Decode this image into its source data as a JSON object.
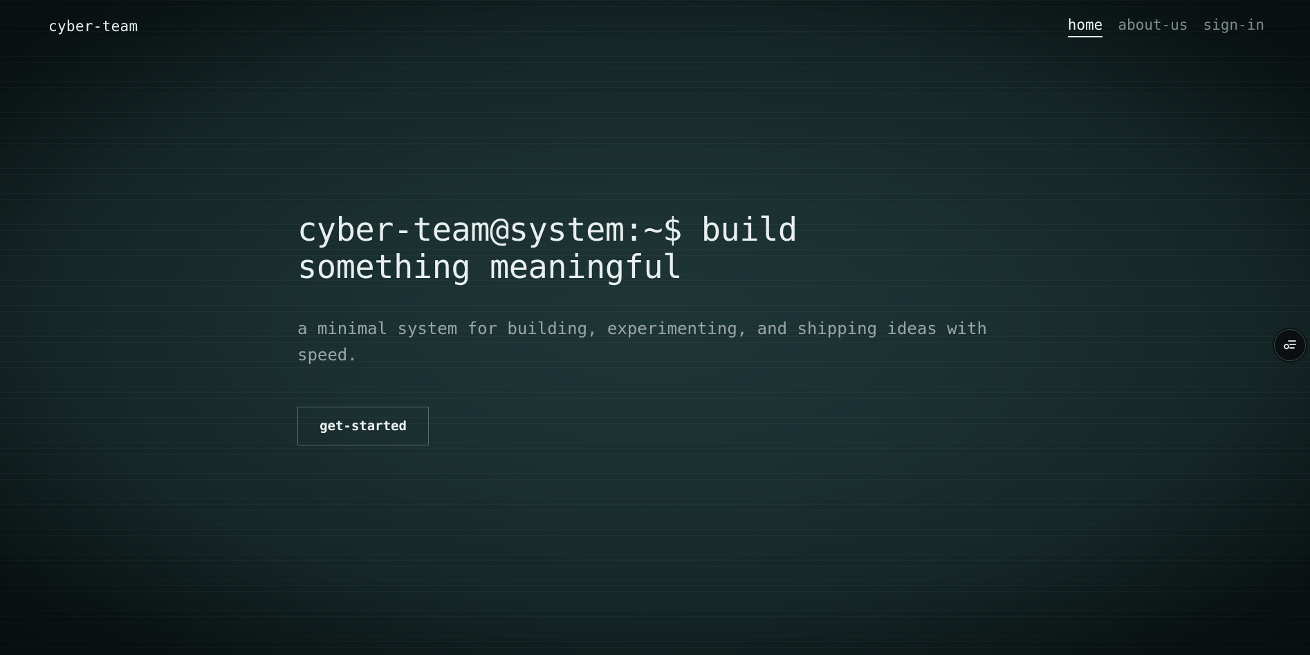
{
  "header": {
    "brand": "cyber-team",
    "nav": [
      {
        "label": "home",
        "active": true
      },
      {
        "label": "about-us",
        "active": false
      },
      {
        "label": "sign-in",
        "active": false
      }
    ]
  },
  "hero": {
    "title": "cyber-team@system:~$ build something meaningful",
    "subtitle": "a minimal system for building, experimenting, and shipping ideas with speed.",
    "cta_label": "get-started"
  },
  "floating_button": {
    "icon": "settings-sliders-icon"
  },
  "colors": {
    "background": "#1b3031",
    "text_primary": "#e9efef",
    "text_muted": "#9aa6a6",
    "nav_inactive": "#7f8c8c"
  }
}
